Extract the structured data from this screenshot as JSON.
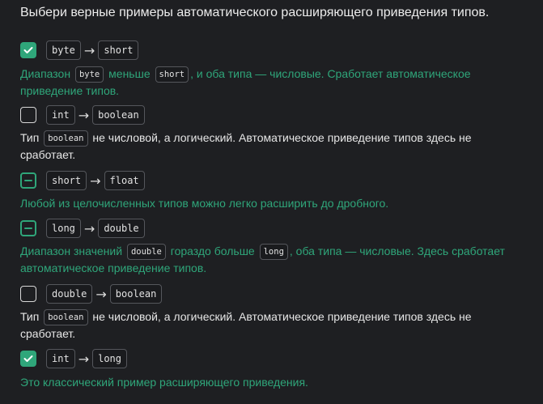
{
  "question": "Выбери верные примеры автоматического расширяющего приведения типов.",
  "arrow": "→",
  "options": [
    {
      "state": "checked",
      "from": "byte",
      "to": "short",
      "feedback": {
        "status": "correct",
        "p1": "Диапазон",
        "c1": "byte",
        "p2": "меньше",
        "c2": "short",
        "p3": ", и оба типа — числовые. Сработает автоматическое приведение типов."
      }
    },
    {
      "state": "empty",
      "from": "int",
      "to": "boolean",
      "feedback": {
        "status": "neutral",
        "p1": "Тип",
        "c1": "boolean",
        "p2": "не числовой, а логический. Автоматическое приведение типов здесь не сработает."
      }
    },
    {
      "state": "partial",
      "from": "short",
      "to": "float",
      "feedback": {
        "status": "correct",
        "p1": "Любой из целочисленных типов можно легко расширить до дробного."
      }
    },
    {
      "state": "partial",
      "from": "long",
      "to": "double",
      "feedback": {
        "status": "correct",
        "p1": "Диапазон значений",
        "c1": "double",
        "p2": "гораздо больше",
        "c2": "long",
        "p3": ", оба типа — числовые. Здесь сработает автоматическое приведение типов."
      }
    },
    {
      "state": "empty",
      "from": "double",
      "to": "boolean",
      "feedback": {
        "status": "neutral",
        "p1": "Тип",
        "c1": "boolean",
        "p2": "не числовой, а логический. Автоматическое приведение типов здесь не сработает."
      }
    },
    {
      "state": "checked",
      "from": "int",
      "to": "long",
      "feedback": {
        "status": "correct",
        "p1": "Это классический пример расширяющего приведения."
      }
    }
  ],
  "colors": {
    "background": "#1e1f22",
    "correct": "#2fa67a",
    "text": "#e6e6e6"
  },
  "icons": {
    "checked": "checkmark-icon",
    "partial": "minus-icon"
  }
}
